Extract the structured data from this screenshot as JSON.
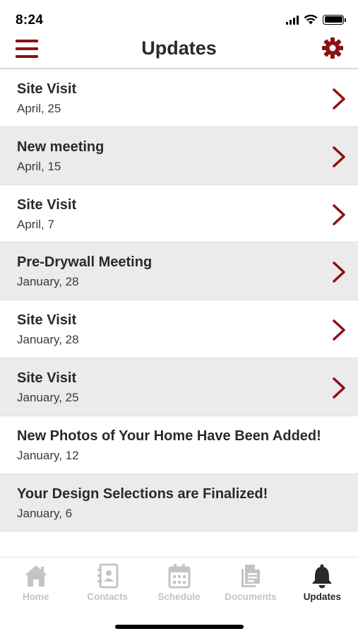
{
  "status_bar": {
    "time": "8:24"
  },
  "header": {
    "title": "Updates"
  },
  "colors": {
    "accent": "#8b1212",
    "alt_row": "#ebebeb",
    "tab_inactive": "#c4c4c4",
    "tab_active": "#2a2a2a"
  },
  "updates": [
    {
      "title": "Site Visit",
      "date": "April, 25",
      "has_chevron": true
    },
    {
      "title": "New meeting",
      "date": "April, 15",
      "has_chevron": true
    },
    {
      "title": "Site Visit",
      "date": "April, 7",
      "has_chevron": true
    },
    {
      "title": "Pre-Drywall Meeting",
      "date": "January, 28",
      "has_chevron": true
    },
    {
      "title": "Site Visit",
      "date": "January, 28",
      "has_chevron": true
    },
    {
      "title": "Site Visit",
      "date": "January, 25",
      "has_chevron": true
    },
    {
      "title": "New Photos of Your Home Have Been Added!",
      "date": "January, 12",
      "has_chevron": false
    },
    {
      "title": "Your Design Selections are Finalized!",
      "date": "January, 6",
      "has_chevron": false
    }
  ],
  "tabs": [
    {
      "label": "Home",
      "icon": "home-icon",
      "active": false
    },
    {
      "label": "Contacts",
      "icon": "contacts-icon",
      "active": false
    },
    {
      "label": "Schedule",
      "icon": "calendar-icon",
      "active": false
    },
    {
      "label": "Documents",
      "icon": "document-icon",
      "active": false
    },
    {
      "label": "Updates",
      "icon": "bell-icon",
      "active": true
    }
  ]
}
